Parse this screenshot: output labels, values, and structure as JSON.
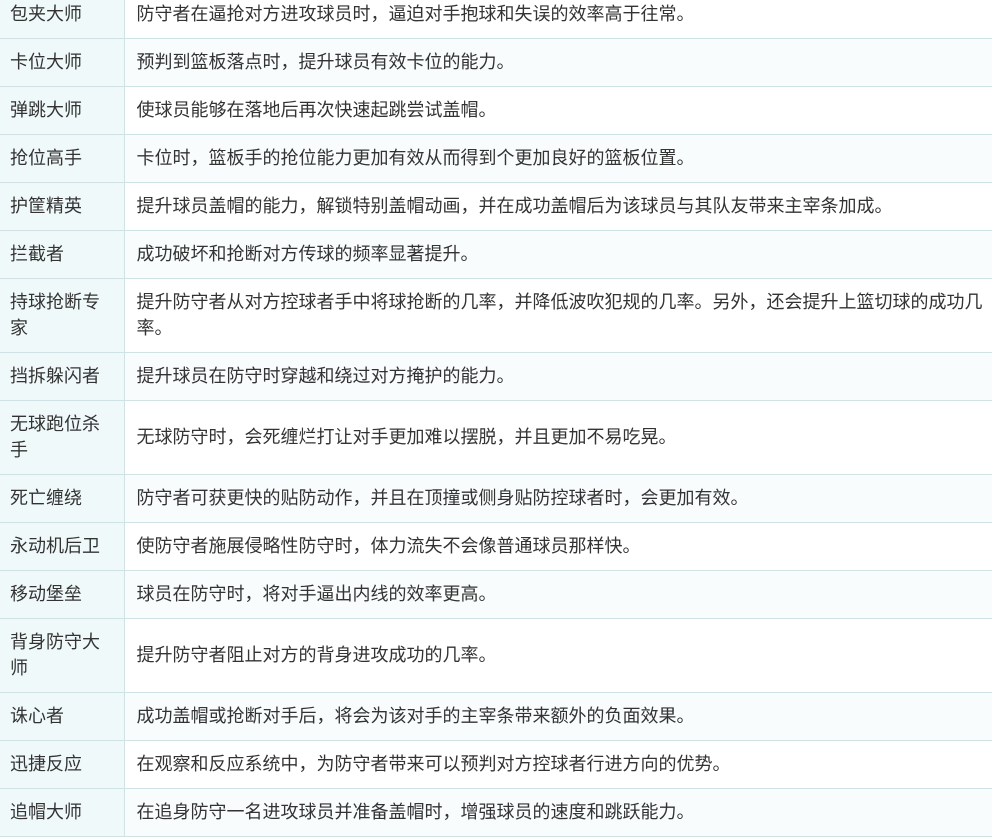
{
  "rows": [
    {
      "name": "包夹大师",
      "desc": "防守者在逼抢对方进攻球员时，逼迫对手抱球和失误的效率高于往常。"
    },
    {
      "name": "卡位大师",
      "desc": "预判到篮板落点时，提升球员有效卡位的能力。"
    },
    {
      "name": "弹跳大师",
      "desc": "使球员能够在落地后再次快速起跳尝试盖帽。"
    },
    {
      "name": "抢位高手",
      "desc": "卡位时，篮板手的抢位能力更加有效从而得到个更加良好的篮板位置。"
    },
    {
      "name": "护筐精英",
      "desc": "提升球员盖帽的能力，解锁特别盖帽动画，并在成功盖帽后为该球员与其队友带来主宰条加成。"
    },
    {
      "name": "拦截者",
      "desc": "成功破坏和抢断对方传球的频率显著提升。"
    },
    {
      "name": "持球抢断专家",
      "desc": "提升防守者从对方控球者手中将球抢断的几率，并降低波吹犯规的几率。另外，还会提升上篮切球的成功几率。"
    },
    {
      "name": "挡拆躲闪者",
      "desc": "提升球员在防守时穿越和绕过对方掩护的能力。"
    },
    {
      "name": "无球跑位杀手",
      "desc": "无球防守时，会死缠烂打让对手更加难以摆脱，并且更加不易吃晃。"
    },
    {
      "name": "死亡缠绕",
      "desc": "防守者可获更快的贴防动作，并且在顶撞或侧身贴防控球者时，会更加有效。"
    },
    {
      "name": "永动机后卫",
      "desc": "使防守者施展侵略性防守时，体力流失不会像普通球员那样快。"
    },
    {
      "name": "移动堡垒",
      "desc": "球员在防守时，将对手逼出内线的效率更高。"
    },
    {
      "name": "背身防守大师",
      "desc": "提升防守者阻止对方的背身进攻成功的几率。"
    },
    {
      "name": "诛心者",
      "desc": "成功盖帽或抢断对手后，将会为该对手的主宰条带来额外的负面效果。"
    },
    {
      "name": "迅捷反应",
      "desc": "在观察和反应系统中，为防守者带来可以预判对方控球者行进方向的优势。"
    },
    {
      "name": "追帽大师",
      "desc": "在追身防守一名进攻球员并准备盖帽时，增强球员的速度和跳跃能力。"
    }
  ]
}
